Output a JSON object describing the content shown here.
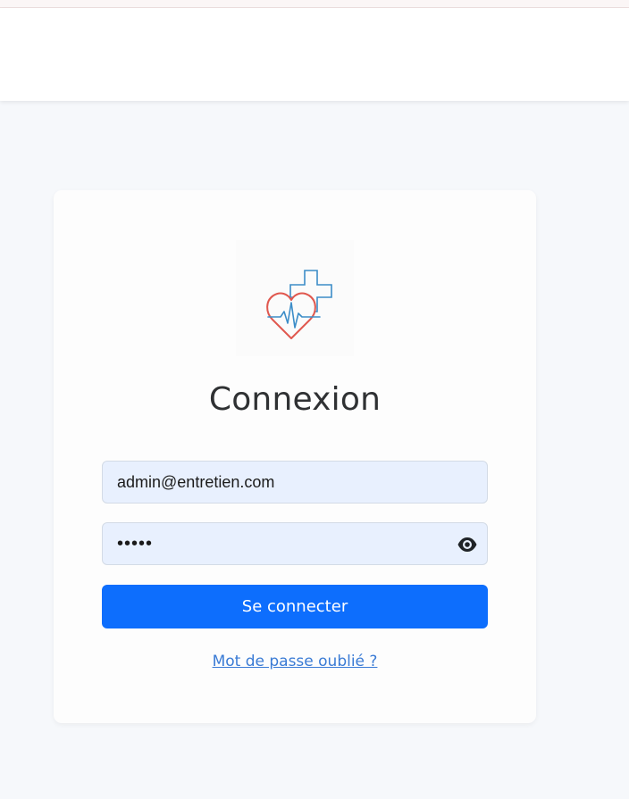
{
  "login": {
    "title": "Connexion",
    "email_value": "admin@entretien.com",
    "password_value": "•••••",
    "submit_label": "Se connecter",
    "forgot_link": "Mot de passe oublié ?"
  },
  "icons": {
    "logo": "heart-cross-pulse-icon",
    "password_toggle": "eye-icon"
  },
  "colors": {
    "primary_button": "#0d6efd",
    "link": "#3a7bd5",
    "input_background": "#e8f0fe",
    "logo_heart": "#e0584f",
    "logo_cross": "#3c8dc8"
  }
}
